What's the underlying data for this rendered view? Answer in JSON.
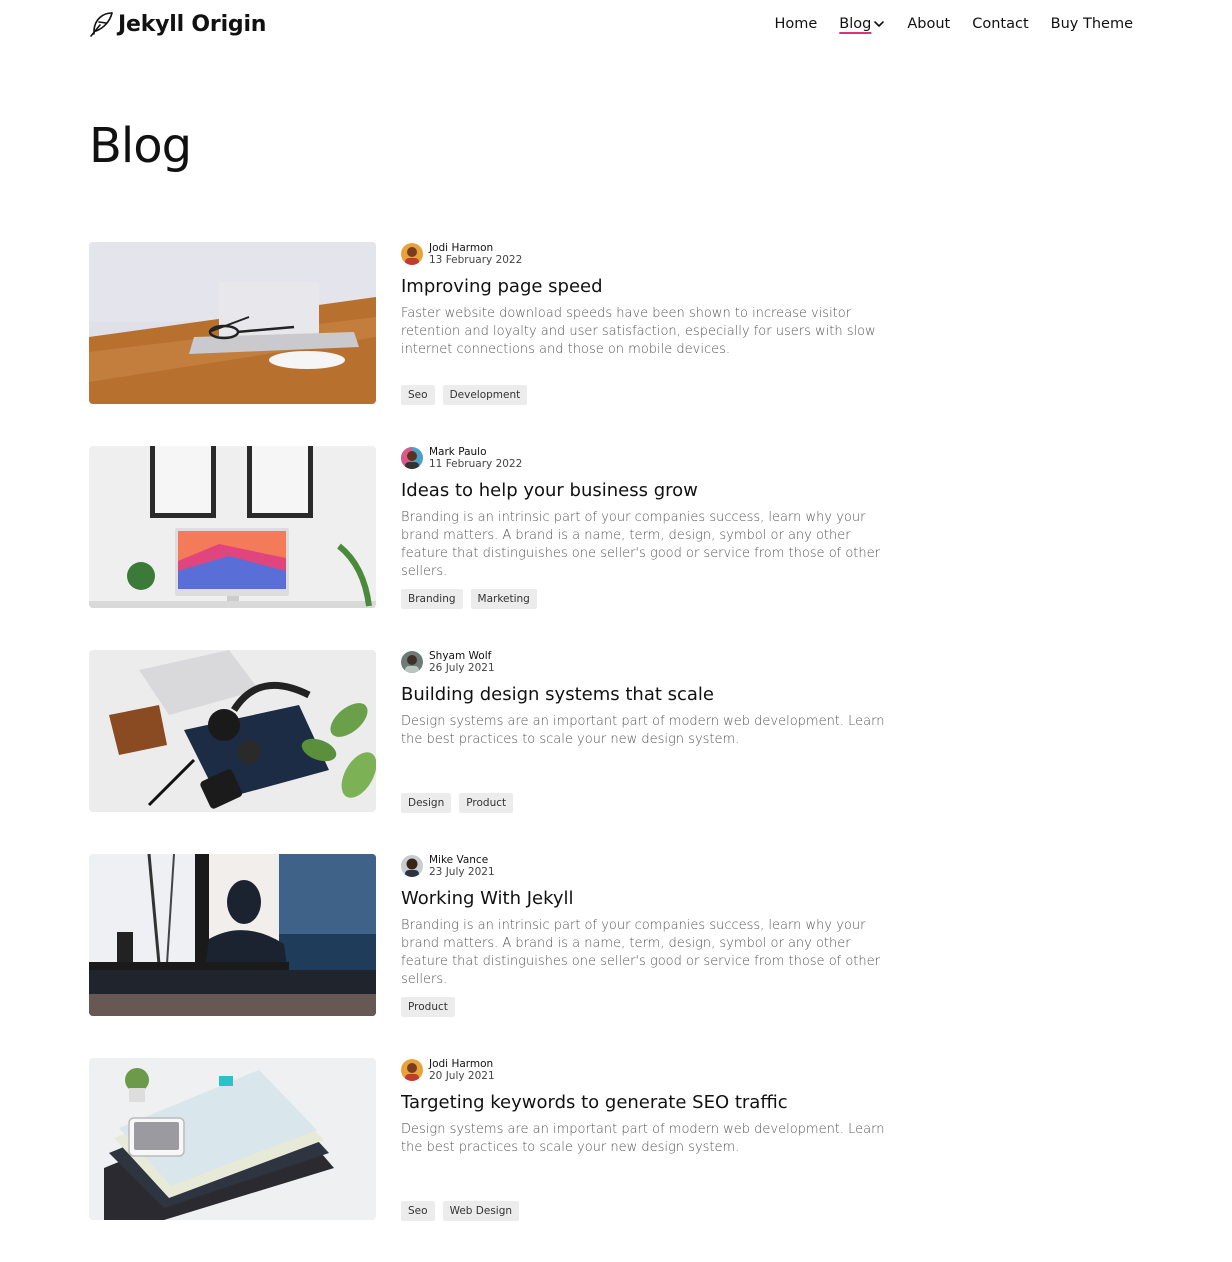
{
  "site": {
    "name": "Jekyll Origin",
    "logo_icon": "feather-icon"
  },
  "nav": {
    "items": [
      {
        "label": "Home"
      },
      {
        "label": "Blog"
      },
      {
        "label": "About"
      },
      {
        "label": "Contact"
      },
      {
        "label": "Buy Theme"
      }
    ],
    "active_index": 1,
    "accent_color": "#e0307a"
  },
  "page": {
    "title": "Blog"
  },
  "posts": [
    {
      "author": "Jodi Harmon",
      "date": "13 February 2022",
      "title": "Improving page speed",
      "excerpt": "Faster website download speeds have been shown to increase visitor retention and loyalty and user satisfaction, especially for users with slow internet connections and those on mobile devices.",
      "tags": [
        "Seo",
        "Development"
      ],
      "image": "laptop-glasses-on-wooden-desk"
    },
    {
      "author": "Mark Paulo",
      "date": "11 February 2022",
      "title": "Ideas to help your business grow",
      "excerpt": "Branding is an intrinsic part of your companies success, learn why your brand matters. A brand is a name, term, design, symbol or any other feature that distinguishes one seller's good or service from those of other sellers.",
      "tags": [
        "Branding",
        "Marketing"
      ],
      "image": "desktop-monitor-with-framed-posters"
    },
    {
      "author": "Shyam Wolf",
      "date": "26 July 2021",
      "title": "Building design systems that scale",
      "excerpt": "Design systems are an important part of modern web development. Learn the best practices to scale your new design system.",
      "tags": [
        "Design",
        "Product"
      ],
      "image": "flatlay-headphones-wallet-phone"
    },
    {
      "author": "Mike Vance",
      "date": "23 July 2021",
      "title": "Working With Jekyll",
      "excerpt": "Branding is an intrinsic part of your companies success, learn why your brand matters. A brand is a name, term, design, symbol or any other feature that distinguishes one seller's good or service from those of other sellers.",
      "tags": [
        "Product"
      ],
      "image": "silhouette-person-at-window"
    },
    {
      "author": "Jodi Harmon",
      "date": "20 July 2021",
      "title": "Targeting keywords to generate SEO traffic",
      "excerpt": "Design systems are an important part of modern web development. Learn the best practices to scale your new design system.",
      "tags": [
        "Seo",
        "Web Design"
      ],
      "image": "stack-of-books-with-phone"
    }
  ]
}
